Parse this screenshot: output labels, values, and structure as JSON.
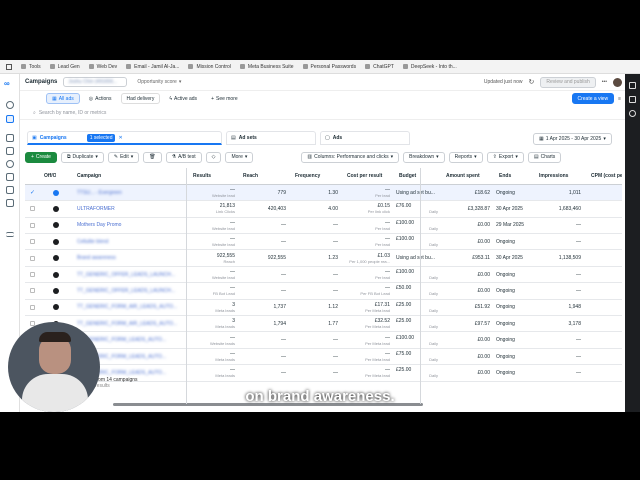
{
  "bookmarks": [
    "Tools",
    "Lead Gen",
    "Web Dev",
    "Email - Jamil Al-Ja...",
    "Mission Control",
    "Meta Business Suite",
    "Personal Passwords",
    "ChatGPT",
    "DeepSeek - Into th..."
  ],
  "header": {
    "title": "Campaigns",
    "account": "Joshu Chin (491656...",
    "opportunity": "Opportunity score",
    "updated": "Updated just now",
    "review": "Review and publish"
  },
  "filters": {
    "all_ads": "All ads",
    "actions": "Actions",
    "had_delivery": "Had delivery",
    "active_ads": "Active ads",
    "see_more": "See more",
    "create_view": "Create a view"
  },
  "search": {
    "placeholder": "Search by name, ID or metrics"
  },
  "tabs": {
    "campaigns": "Campaigns",
    "selected": "1 selected",
    "ad_sets": "Ad sets",
    "ads": "Ads"
  },
  "date_range": "1 Apr 2025 - 30 Apr 2025",
  "toolbar": {
    "create": "Create",
    "duplicate": "Duplicate",
    "edit": "Edit",
    "ab_test": "A/B test",
    "more": "More",
    "columns": "Columns: Performance and clicks",
    "breakdown": "Breakdown",
    "reports": "Reports",
    "export": "Export",
    "charts": "Charts"
  },
  "table": {
    "headers": {
      "offon": "Off/On",
      "campaign": "Campaign",
      "results": "Results",
      "reach": "Reach",
      "frequency": "Frequency",
      "cost": "Cost per result",
      "budget": "Budget",
      "amount": "Amount spent",
      "ends": "Ends",
      "impressions": "Impressions",
      "cpm": "CPM (cost per 1,000..."
    },
    "rows": [
      {
        "name": "TTSU... - Evergreen",
        "results": "—",
        "results_sub": "Website lead",
        "reach": "779",
        "freq": "1.30",
        "cost": "—",
        "cost_sub": "Per lead",
        "budget": "Using ad set bu...",
        "budget_sub": "",
        "spent": "£18.62",
        "ends": "Ongoing",
        "impr": "1,011",
        "on": true
      },
      {
        "name": "ULTRAFORMER",
        "results": "21,813",
        "results_sub": "Link Clicks",
        "reach": "420,403",
        "freq": "4.00",
        "cost": "£0.15",
        "cost_sub": "Per link click",
        "budget": "£76.00",
        "budget_sub": "Daily",
        "spent": "£3,328.87",
        "ends": "30 Apr 2025",
        "impr": "1,683,460",
        "on": false
      },
      {
        "name": "Mothers Day Promo",
        "results": "—",
        "results_sub": "Website lead",
        "reach": "—",
        "freq": "—",
        "cost": "—",
        "cost_sub": "Per lead",
        "budget": "£100.00",
        "budget_sub": "Daily",
        "spent": "£0.00",
        "ends": "29 Mar 2025",
        "impr": "—",
        "on": false
      },
      {
        "name": "Cellulite blend",
        "results": "—",
        "results_sub": "Website lead",
        "reach": "—",
        "freq": "—",
        "cost": "—",
        "cost_sub": "Per lead",
        "budget": "£100.00",
        "budget_sub": "Daily",
        "spent": "£0.00",
        "ends": "Ongoing",
        "impr": "—",
        "on": false
      },
      {
        "name": "Brand awareness",
        "results": "922,555",
        "results_sub": "Reach",
        "reach": "922,555",
        "freq": "1.23",
        "cost": "£1.03",
        "cost_sub": "Per 1,000 people rea...",
        "budget": "Using ad set bu...",
        "budget_sub": "",
        "spent": "£953.11",
        "ends": "30 Apr 2025",
        "impr": "1,138,509",
        "on": false
      },
      {
        "name": "TT_GENERIC_OFFER_LEADS_LAUNCH...",
        "results": "—",
        "results_sub": "Website lead",
        "reach": "—",
        "freq": "—",
        "cost": "—",
        "cost_sub": "Per lead",
        "budget": "£100.00",
        "budget_sub": "Daily",
        "spent": "£0.00",
        "ends": "Ongoing",
        "impr": "—",
        "on": false
      },
      {
        "name": "TT_GENERIC_OFFER_LEADS_LAUNCH...",
        "results": "—",
        "results_sub": "FB Bot Lead",
        "reach": "—",
        "freq": "—",
        "cost": "—",
        "cost_sub": "Per FB Bot Lead",
        "budget": "£50.00",
        "budget_sub": "Daily",
        "spent": "£0.00",
        "ends": "Ongoing",
        "impr": "—",
        "on": false
      },
      {
        "name": "TT_GENERIC_FORM_AIR_LEADS_AUTO...",
        "results": "3",
        "results_sub": "Meta leads",
        "reach": "1,737",
        "freq": "1.12",
        "cost": "£17.31",
        "cost_sub": "Per Meta lead",
        "budget": "£25.00",
        "budget_sub": "Daily",
        "spent": "£51.92",
        "ends": "Ongoing",
        "impr": "1,948",
        "on": false
      },
      {
        "name": "TT_GENERIC_FORM_AIR_LEADS_AUTO...",
        "results": "3",
        "results_sub": "Meta leads",
        "reach": "1,794",
        "freq": "1.77",
        "cost": "£32.52",
        "cost_sub": "Per Meta lead",
        "budget": "£25.00",
        "budget_sub": "Daily",
        "spent": "£97.57",
        "ends": "Ongoing",
        "impr": "3,178",
        "on": false
      },
      {
        "name": "TT_GENERIC_FORM_LEADS_AUTO...",
        "results": "—",
        "results_sub": "Website leads",
        "reach": "—",
        "freq": "—",
        "cost": "—",
        "cost_sub": "Per Meta lead",
        "budget": "£100.00",
        "budget_sub": "Daily",
        "spent": "£0.00",
        "ends": "Ongoing",
        "impr": "—",
        "on": false
      },
      {
        "name": "TT_GENERIC_FORM_LEADS_AUTO...",
        "results": "—",
        "results_sub": "Meta leads",
        "reach": "—",
        "freq": "—",
        "cost": "—",
        "cost_sub": "Per Meta lead",
        "budget": "£75.00",
        "budget_sub": "Daily",
        "spent": "£0.00",
        "ends": "Ongoing",
        "impr": "—",
        "on": false
      },
      {
        "name": "TT_GENERIC_FORM_LEADS_AUTO...",
        "results": "—",
        "results_sub": "Meta leads",
        "reach": "—",
        "freq": "—",
        "cost": "—",
        "cost_sub": "Per Meta lead",
        "budget": "£25.00",
        "budget_sub": "Daily",
        "spent": "£0.00",
        "ends": "Ongoing",
        "impr": "—",
        "on": false
      }
    ],
    "footer": "from 14 campaigns",
    "footer_sub": "results"
  },
  "caption": "on brand awareness."
}
